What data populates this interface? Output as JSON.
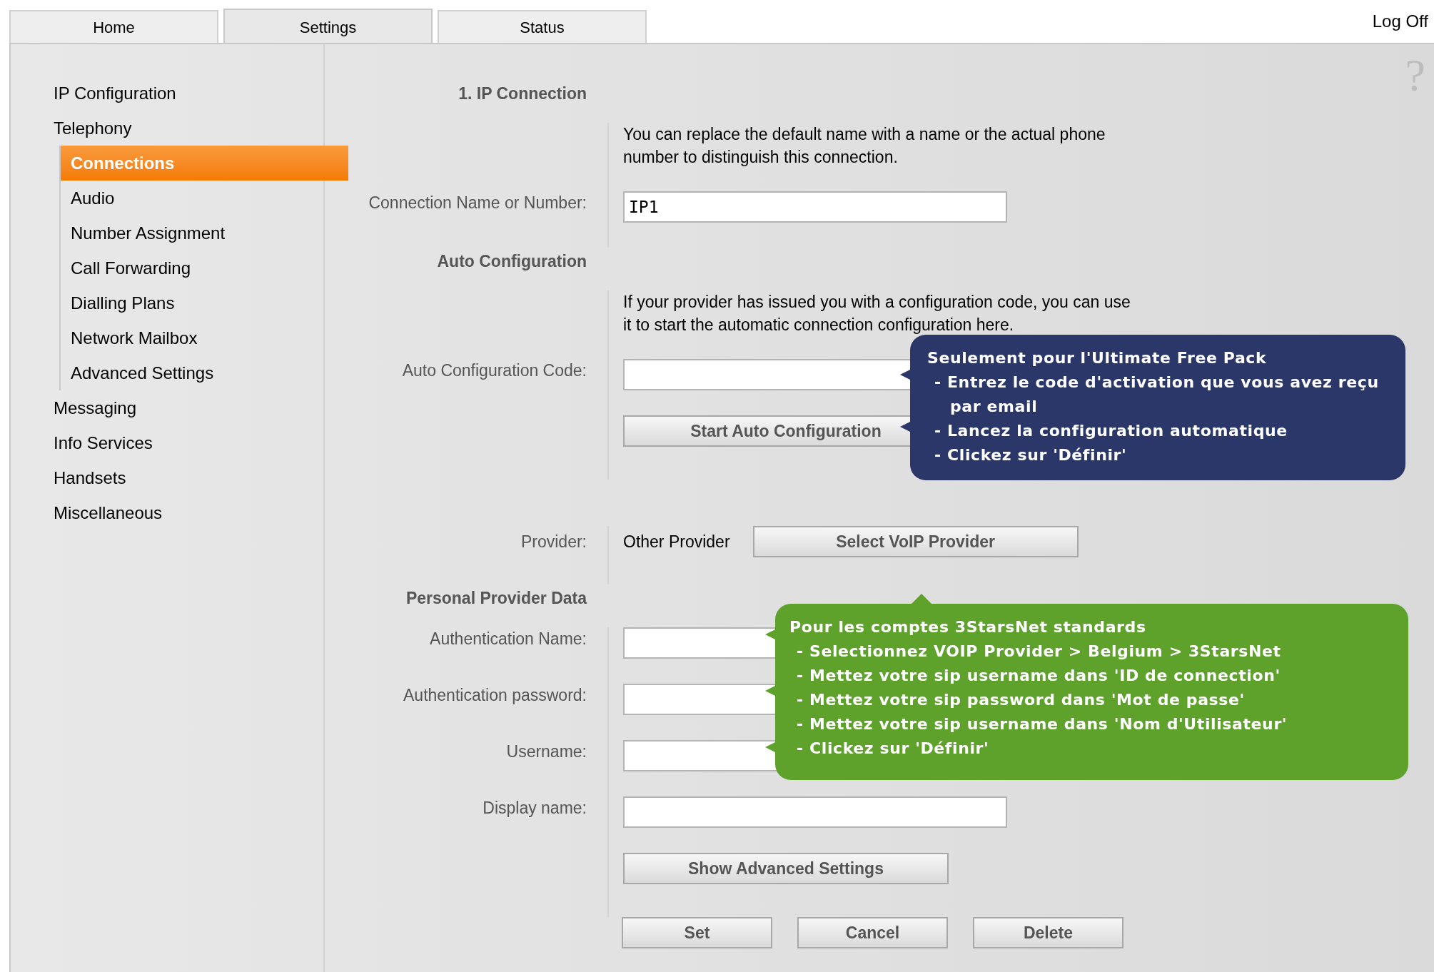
{
  "tabs": [
    {
      "label": "Home",
      "selected": false
    },
    {
      "label": "Settings",
      "selected": true
    },
    {
      "label": "Status",
      "selected": false
    }
  ],
  "log_off": "Log Off",
  "help": "?",
  "sidebar": [
    {
      "label": "IP Configuration",
      "selected": false
    },
    {
      "label": "Telephony",
      "selected": false,
      "children": [
        {
          "label": "Connections",
          "selected": true
        },
        {
          "label": "Audio",
          "selected": false
        },
        {
          "label": "Number Assignment",
          "selected": false
        },
        {
          "label": "Call Forwarding",
          "selected": false
        },
        {
          "label": "Dialling Plans",
          "selected": false
        },
        {
          "label": "Network Mailbox",
          "selected": false
        },
        {
          "label": "Advanced Settings",
          "selected": false
        }
      ]
    },
    {
      "label": "Messaging",
      "selected": false
    },
    {
      "label": "Info Services",
      "selected": false
    },
    {
      "label": "Handsets",
      "selected": false
    },
    {
      "label": "Miscellaneous",
      "selected": false
    }
  ],
  "form": [
    {
      "kind": "heading",
      "label": "1. IP Connection"
    },
    {
      "kind": "note",
      "text": "You can replace the default name with a name or the actual phone number to distinguish this connection."
    },
    {
      "kind": "field",
      "label": "Connection Name or Number:",
      "value": "IP1"
    },
    {
      "kind": "heading",
      "label": "Auto Configuration"
    },
    {
      "kind": "note",
      "text": "If your provider has issued you with a configuration code, you can use it to start the automatic connection configuration here."
    },
    {
      "kind": "field",
      "label": "Auto Configuration Code:"
    },
    {
      "kind": "button",
      "buttons": [
        "Start Auto Configuration"
      ]
    },
    {
      "kind": "provider",
      "label": "Provider:",
      "value": "Other Provider",
      "button": "Select VoIP Provider"
    },
    {
      "kind": "heading",
      "label": "Personal Provider Data"
    },
    {
      "kind": "field",
      "label": "Authentication Name:"
    },
    {
      "kind": "field",
      "label": "Authentication password:"
    },
    {
      "kind": "field",
      "label": "Username:"
    },
    {
      "kind": "field",
      "label": "Display name:"
    },
    {
      "kind": "button",
      "buttons": [
        "Show Advanced Settings"
      ]
    },
    {
      "kind": "actions",
      "buttons": [
        "Set",
        "Cancel",
        "Delete"
      ]
    }
  ],
  "callouts": [
    {
      "color": "#2a3768",
      "title": "Seulement pour l'Ultimate Free Pack",
      "lines": [
        "- Entrez le code d'activation que vous avez reçu par email",
        "- Lancez la configuration automatique",
        "- Clickez sur 'Définir'"
      ]
    },
    {
      "color": "#5ea22c",
      "title": "Pour les comptes 3StarsNet standards",
      "lines": [
        "- Selectionnez VOIP Provider > Belgium > 3StarsNet",
        "- Mettez votre sip username dans 'ID de connection'",
        "- Mettez votre sip password dans 'Mot de passe'",
        "- Mettez votre sip username dans 'Nom d'Utilisateur'",
        "- Clickez sur 'Définir'"
      ]
    }
  ]
}
